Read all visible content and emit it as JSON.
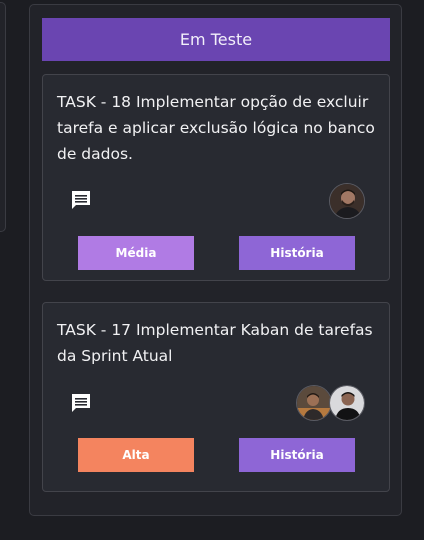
{
  "column": {
    "title": "Em Teste"
  },
  "cards": [
    {
      "title": "TASK - 18 Implementar opção de excluir tarefa e aplicar exclusão lógica no banco de dados.",
      "comment_icon": "comment-icon",
      "priority": {
        "label": "Média",
        "color": "#b07be4"
      },
      "type": {
        "label": "História",
        "color": "#8e66d6"
      },
      "assignees": 1
    },
    {
      "title": "TASK - 17 Implementar Kaban de tarefas da Sprint Atual",
      "comment_icon": "comment-icon",
      "priority": {
        "label": "Alta",
        "color": "#f4845f"
      },
      "type": {
        "label": "História",
        "color": "#8e66d6"
      },
      "assignees": 2
    }
  ],
  "colors": {
    "background": "#1c1d22",
    "header": "#6a45b1"
  }
}
